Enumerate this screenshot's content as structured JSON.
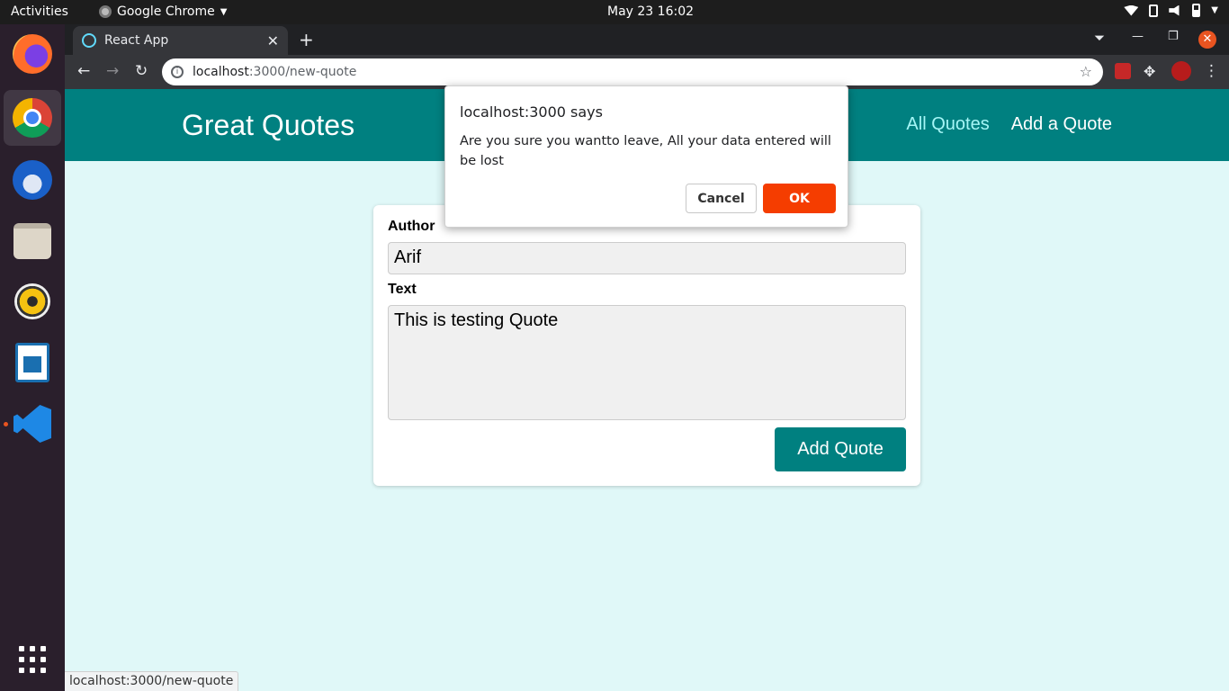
{
  "topbar": {
    "activities": "Activities",
    "app_name": "Google Chrome",
    "clock": "May 23  16:02"
  },
  "dock": {
    "items": [
      "firefox",
      "chrome",
      "thunderbird",
      "files",
      "rhythmbox",
      "libreoffice-writer",
      "vscode",
      "show-apps"
    ]
  },
  "browser": {
    "tab_title": "React App",
    "url_host": "localhost",
    "url_path": ":3000/new-quote",
    "status_url": "localhost:3000/new-quote"
  },
  "app": {
    "logo": "Great Quotes",
    "nav": [
      "All Quotes",
      "Add a Quote"
    ]
  },
  "form": {
    "author_label": "Author",
    "author_value": "Arif",
    "text_label": "Text",
    "text_value": "This is testing Quote",
    "submit_label": "Add Quote"
  },
  "dialog": {
    "title": "localhost:3000 says",
    "message": "Are you sure you wantto leave, All your data entered will be lost",
    "cancel_label": "Cancel",
    "ok_label": "OK"
  },
  "colors": {
    "header_bg": "#008080",
    "page_bg": "#e0f8f8",
    "ok_button": "#f53d00"
  }
}
